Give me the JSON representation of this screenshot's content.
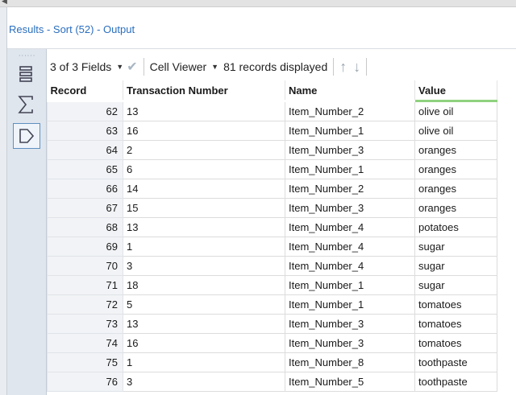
{
  "header": {
    "title": "Results - Sort (52) - Output"
  },
  "toolbar": {
    "fields_label": "3 of 3 Fields",
    "viewer_label": "Cell Viewer",
    "records_label": "81 records displayed"
  },
  "table": {
    "columns": [
      "Record",
      "Transaction Number",
      "Name",
      "Value"
    ],
    "rows": [
      [
        "62",
        "13",
        "Item_Number_2",
        "olive oil"
      ],
      [
        "63",
        "16",
        "Item_Number_1",
        "olive oil"
      ],
      [
        "64",
        "2",
        "Item_Number_3",
        "oranges"
      ],
      [
        "65",
        "6",
        "Item_Number_1",
        "oranges"
      ],
      [
        "66",
        "14",
        "Item_Number_2",
        "oranges"
      ],
      [
        "67",
        "15",
        "Item_Number_3",
        "oranges"
      ],
      [
        "68",
        "13",
        "Item_Number_4",
        "potatoes"
      ],
      [
        "69",
        "1",
        "Item_Number_4",
        "sugar"
      ],
      [
        "70",
        "3",
        "Item_Number_4",
        "sugar"
      ],
      [
        "71",
        "18",
        "Item_Number_1",
        "sugar"
      ],
      [
        "72",
        "5",
        "Item_Number_1",
        "tomatoes"
      ],
      [
        "73",
        "13",
        "Item_Number_3",
        "tomatoes"
      ],
      [
        "74",
        "16",
        "Item_Number_3",
        "tomatoes"
      ],
      [
        "75",
        "1",
        "Item_Number_8",
        "toothpaste"
      ],
      [
        "76",
        "3",
        "Item_Number_5",
        "toothpaste"
      ]
    ]
  },
  "colors": {
    "accent": "#2a6ebf",
    "value_underline": "#8fd17f"
  }
}
